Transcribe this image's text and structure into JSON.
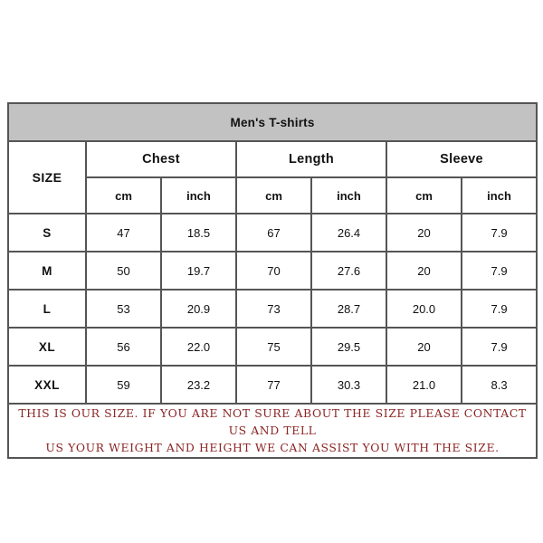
{
  "chart": {
    "title": "Men's T-shirts",
    "size_header": "SIZE",
    "groups": [
      {
        "label": "Chest",
        "units": [
          "cm",
          "inch"
        ]
      },
      {
        "label": "Length",
        "units": [
          "cm",
          "inch"
        ]
      },
      {
        "label": "Sleeve",
        "units": [
          "cm",
          "inch"
        ]
      }
    ],
    "rows": [
      {
        "size": "S",
        "chest_cm": "47",
        "chest_inch": "18.5",
        "length_cm": "67",
        "length_inch": "26.4",
        "sleeve_cm": "20",
        "sleeve_inch": "7.9"
      },
      {
        "size": "M",
        "chest_cm": "50",
        "chest_inch": "19.7",
        "length_cm": "70",
        "length_inch": "27.6",
        "sleeve_cm": "20",
        "sleeve_inch": "7.9"
      },
      {
        "size": "L",
        "chest_cm": "53",
        "chest_inch": "20.9",
        "length_cm": "73",
        "length_inch": "28.7",
        "sleeve_cm": "20.0",
        "sleeve_inch": "7.9"
      },
      {
        "size": "XL",
        "chest_cm": "56",
        "chest_inch": "22.0",
        "length_cm": "75",
        "length_inch": "29.5",
        "sleeve_cm": "20",
        "sleeve_inch": "7.9"
      },
      {
        "size": "XXL",
        "chest_cm": "59",
        "chest_inch": "23.2",
        "length_cm": "77",
        "length_inch": "30.3",
        "sleeve_cm": "21.0",
        "sleeve_inch": "8.3"
      }
    ],
    "note": {
      "line1": "THIS IS OUR SIZE. IF YOU ARE NOT SURE ABOUT THE SIZE  PLEASE CONTACT US AND TELL",
      "line2": "US YOUR WEIGHT AND HEIGHT WE CAN ASSIST YOU WITH THE SIZE."
    },
    "colors": {
      "title_bar": "#c2c2c2",
      "border": "#555555",
      "note_text": "#8b2424",
      "cell_background": "#ffffff"
    }
  },
  "chart_data": {
    "type": "table",
    "title": "Men's T-shirts",
    "columns": [
      "SIZE",
      "Chest cm",
      "Chest inch",
      "Length cm",
      "Length inch",
      "Sleeve cm",
      "Sleeve inch"
    ],
    "rows": [
      [
        "S",
        47,
        18.5,
        67,
        26.4,
        20,
        7.9
      ],
      [
        "M",
        50,
        19.7,
        70,
        27.6,
        20,
        7.9
      ],
      [
        "L",
        53,
        20.9,
        73,
        28.7,
        20.0,
        7.9
      ],
      [
        "XL",
        56,
        22.0,
        75,
        29.5,
        20,
        7.9
      ],
      [
        "XXL",
        59,
        23.2,
        77,
        30.3,
        21.0,
        8.3
      ]
    ]
  }
}
